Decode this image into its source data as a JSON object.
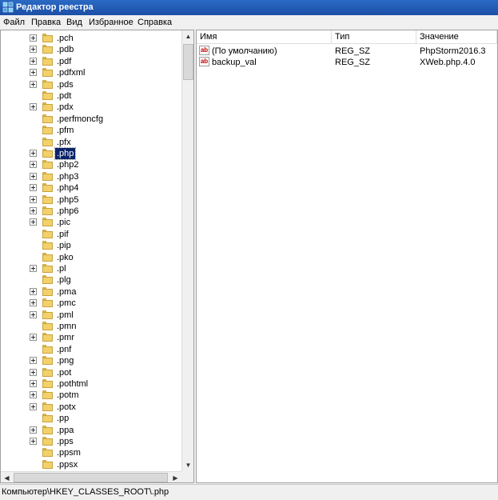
{
  "window": {
    "title": "Редактор реестра"
  },
  "menu": [
    "Файл",
    "Правка",
    "Вид",
    "Избранное",
    "Справка"
  ],
  "tree": {
    "items": [
      {
        "label": ".pch",
        "expandable": true
      },
      {
        "label": ".pdb",
        "expandable": true
      },
      {
        "label": ".pdf",
        "expandable": true
      },
      {
        "label": ".pdfxml",
        "expandable": true
      },
      {
        "label": ".pds",
        "expandable": true
      },
      {
        "label": ".pdt",
        "expandable": false
      },
      {
        "label": ".pdx",
        "expandable": true
      },
      {
        "label": ".perfmoncfg",
        "expandable": false
      },
      {
        "label": ".pfm",
        "expandable": false
      },
      {
        "label": ".pfx",
        "expandable": false
      },
      {
        "label": ".php",
        "expandable": true,
        "selected": true
      },
      {
        "label": ".php2",
        "expandable": true
      },
      {
        "label": ".php3",
        "expandable": true
      },
      {
        "label": ".php4",
        "expandable": true
      },
      {
        "label": ".php5",
        "expandable": true
      },
      {
        "label": ".php6",
        "expandable": true
      },
      {
        "label": ".pic",
        "expandable": true
      },
      {
        "label": ".pif",
        "expandable": false
      },
      {
        "label": ".pip",
        "expandable": false
      },
      {
        "label": ".pko",
        "expandable": false
      },
      {
        "label": ".pl",
        "expandable": true
      },
      {
        "label": ".plg",
        "expandable": false
      },
      {
        "label": ".pma",
        "expandable": true
      },
      {
        "label": ".pmc",
        "expandable": true
      },
      {
        "label": ".pml",
        "expandable": true
      },
      {
        "label": ".pmn",
        "expandable": false
      },
      {
        "label": ".pmr",
        "expandable": true
      },
      {
        "label": ".pnf",
        "expandable": false
      },
      {
        "label": ".png",
        "expandable": true
      },
      {
        "label": ".pot",
        "expandable": true
      },
      {
        "label": ".pothtml",
        "expandable": true
      },
      {
        "label": ".potm",
        "expandable": true
      },
      {
        "label": ".potx",
        "expandable": true
      },
      {
        "label": ".pp",
        "expandable": false
      },
      {
        "label": ".ppa",
        "expandable": true
      },
      {
        "label": ".pps",
        "expandable": true
      },
      {
        "label": ".ppsm",
        "expandable": false
      },
      {
        "label": ".ppsx",
        "expandable": false
      }
    ]
  },
  "values": {
    "columns": [
      "Имя",
      "Тип",
      "Значение"
    ],
    "rows": [
      {
        "name": "(По умолчанию)",
        "type": "REG_SZ",
        "data": "PhpStorm2016.3",
        "icon": "string-value-icon"
      },
      {
        "name": "backup_val",
        "type": "REG_SZ",
        "data": "XWeb.php.4.0",
        "icon": "string-value-icon"
      }
    ]
  },
  "status": {
    "path": "Компьютер\\HKEY_CLASSES_ROOT\\.php"
  },
  "colors": {
    "titlebar": "#1c4fa6",
    "selection": "#0a246a",
    "folder": "#f2d16b",
    "reg_icon_text": "#c00000"
  }
}
